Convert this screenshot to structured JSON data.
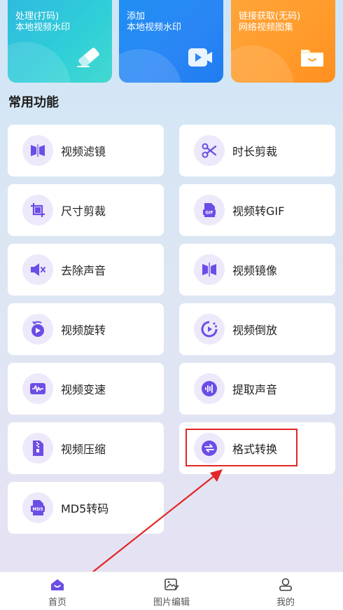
{
  "top_cards": [
    {
      "line1": "处理(打码)",
      "line2": "本地视频水印",
      "icon": "eraser-icon"
    },
    {
      "line1": "添加",
      "line2": "本地视频水印",
      "icon": "video-camera-icon"
    },
    {
      "line1": "链接获取(无码)",
      "line2": "网络视频图集",
      "icon": "folder-icon"
    }
  ],
  "section_title": "常用功能",
  "tools": [
    {
      "label": "视频滤镜",
      "icon": "video-filter-icon"
    },
    {
      "label": "时长剪裁",
      "icon": "scissors-icon"
    },
    {
      "label": "尺寸剪裁",
      "icon": "crop-icon"
    },
    {
      "label": "视频转GIF",
      "icon": "gif-icon"
    },
    {
      "label": "去除声音",
      "icon": "mute-icon"
    },
    {
      "label": "视频镜像",
      "icon": "mirror-icon"
    },
    {
      "label": "视频旋转",
      "icon": "rotate-icon"
    },
    {
      "label": "视频倒放",
      "icon": "reverse-icon"
    },
    {
      "label": "视频变速",
      "icon": "speed-wave-icon"
    },
    {
      "label": "提取声音",
      "icon": "audio-extract-icon"
    },
    {
      "label": "视频压缩",
      "icon": "zip-icon"
    },
    {
      "label": "格式转换",
      "icon": "convert-icon"
    },
    {
      "label": "MD5转码",
      "icon": "md5-icon"
    }
  ],
  "tabbar": [
    {
      "label": "首页",
      "icon": "home-icon",
      "active": true
    },
    {
      "label": "图片编辑",
      "icon": "image-edit-icon",
      "active": false
    },
    {
      "label": "我的",
      "icon": "profile-icon",
      "active": false
    }
  ],
  "colors": {
    "accent": "#6c4de6",
    "icon_bg": "#ede9fb",
    "highlight": "#e32626",
    "card1": "#2fc5dc",
    "card2": "#2b86f5",
    "card3": "#ff9b2b"
  }
}
